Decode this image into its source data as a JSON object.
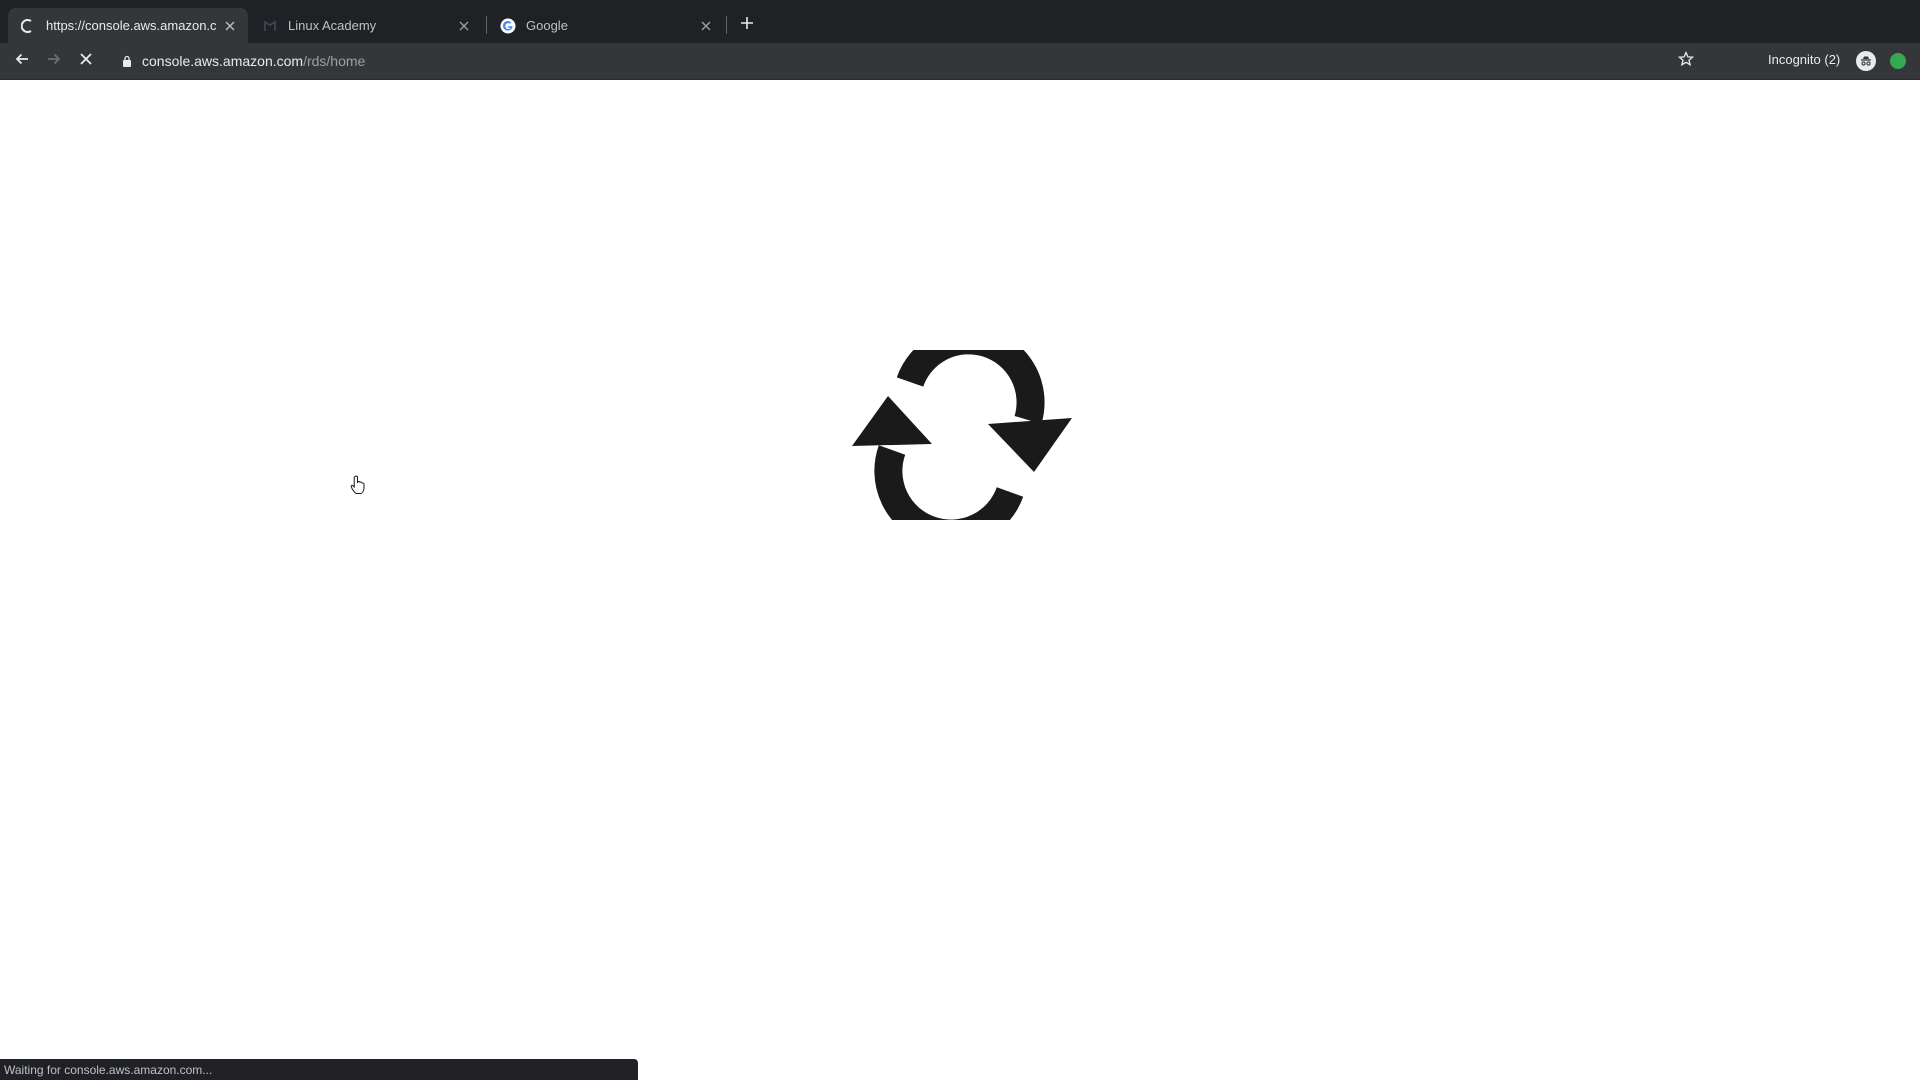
{
  "tabs": [
    {
      "title": "https://console.aws.amazon.com",
      "icon": "loading-spinner-icon",
      "active": true
    },
    {
      "title": "Linux Academy",
      "icon": "linux-academy-icon",
      "active": false
    },
    {
      "title": "Google",
      "icon": "google-icon",
      "active": false
    }
  ],
  "toolbar": {
    "url_host": "console.aws.amazon.com",
    "url_path": "/rds/home",
    "profile_label": "Incognito (2)"
  },
  "status": {
    "text": "Waiting for console.aws.amazon.com..."
  },
  "colors": {
    "tab_strip": "#202124",
    "toolbar": "#35363a",
    "page_background": "#ffffff",
    "spinner": "#1a1a1a",
    "extension_badge": "#34a853"
  }
}
